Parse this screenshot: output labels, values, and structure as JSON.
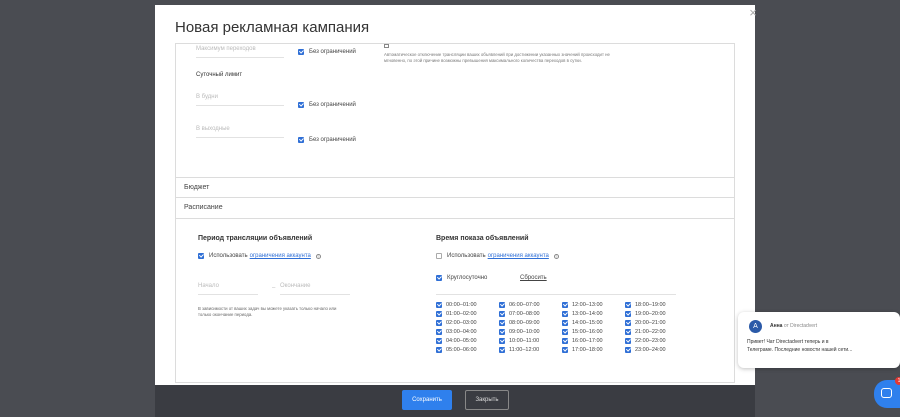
{
  "modal": {
    "title": "Новая рекламная кампания",
    "close": "×"
  },
  "limits": {
    "max_clicks_placeholder": "Максимум переходов",
    "unlimited": "Без ограничений",
    "daily_limit": "Суточный лимит",
    "weekdays_placeholder": "В будни",
    "weekends_placeholder": "В выходные",
    "note": "Автоматическое отключение трансляции ваших объявлений при достижении указанных значений происходит не мгновенно, по этой причине возможны превышения максимального количества переходов в сутки."
  },
  "sections": {
    "budget": "Бюджет",
    "schedule": "Расписание"
  },
  "period": {
    "heading": "Период трансляции объявлений",
    "use_label": "Использовать",
    "use_link": "ограничения аккаунта",
    "help": "?",
    "start_placeholder": "Начало",
    "dash": "–",
    "end_placeholder": "Окончание",
    "hint": "В зависимости от ваших задач вы можете указать только начало или только окончание периода."
  },
  "showtime": {
    "heading": "Время показа объявлений",
    "use_label": "Использовать",
    "use_link": "ограничения аккаунта",
    "help": "?",
    "round_clock": "Круглосуточно",
    "reset": "Сбросить",
    "hours": [
      [
        "00:00–01:00",
        "06:00–07:00",
        "12:00–13:00",
        "18:00–19:00"
      ],
      [
        "01:00–02:00",
        "07:00–08:00",
        "13:00–14:00",
        "19:00–20:00"
      ],
      [
        "02:00–03:00",
        "08:00–09:00",
        "14:00–15:00",
        "20:00–21:00"
      ],
      [
        "03:00–04:00",
        "09:00–10:00",
        "15:00–16:00",
        "21:00–22:00"
      ],
      [
        "04:00–05:00",
        "10:00–11:00",
        "16:00–17:00",
        "22:00–23:00"
      ],
      [
        "05:00–06:00",
        "11:00–12:00",
        "17:00–18:00",
        "23:00–24:00"
      ]
    ]
  },
  "footer": {
    "save": "Сохранить",
    "close": "Закрыть"
  },
  "chat": {
    "avatar_letter": "A",
    "agent": "Анна",
    "from": "от Directadvert",
    "message_line1": "Привет! Чат Directadvert теперь и в",
    "message_line2": "Телеграме. Последние новости нашей сети...",
    "badge": "1"
  },
  "colors": {
    "accent": "#2f80ed",
    "backdrop": "#4a4c52",
    "footer": "#3a3c42"
  }
}
